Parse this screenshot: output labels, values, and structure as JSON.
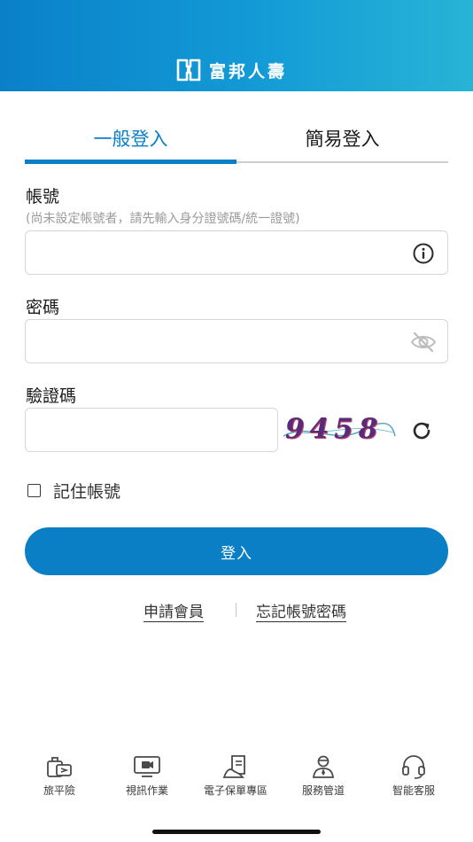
{
  "header": {
    "brand_name": "富邦人壽",
    "background_color": "#0a80c9",
    "logo_icon": "fubon-logo-icon"
  },
  "tabs": [
    {
      "label": "一般登入",
      "active": true
    },
    {
      "label": "簡易登入",
      "active": false
    }
  ],
  "account": {
    "label": "帳號",
    "hint": "(尚未設定帳號者，請先輸入身分證號碼/統一證號)",
    "value": "",
    "icon": "info-icon"
  },
  "password": {
    "label": "密碼",
    "value": "",
    "icon": "eye-off-icon"
  },
  "captcha": {
    "label": "驗證碼",
    "value": "",
    "image_text": "9458",
    "refresh_icon": "refresh-icon"
  },
  "remember": {
    "label": "記住帳號",
    "checked": false
  },
  "login_button": {
    "label": "登入",
    "color": "#0a7fc6"
  },
  "links": {
    "apply": "申請會員",
    "forgot": "忘記帳號密碼"
  },
  "bottom_nav": [
    {
      "label": "旅平險",
      "icon": "luggage-icon"
    },
    {
      "label": "視訊作業",
      "icon": "video-monitor-icon"
    },
    {
      "label": "電子保單專區",
      "icon": "e-policy-icon"
    },
    {
      "label": "服務管道",
      "icon": "service-person-icon"
    },
    {
      "label": "智能客服",
      "icon": "headset-icon"
    }
  ]
}
